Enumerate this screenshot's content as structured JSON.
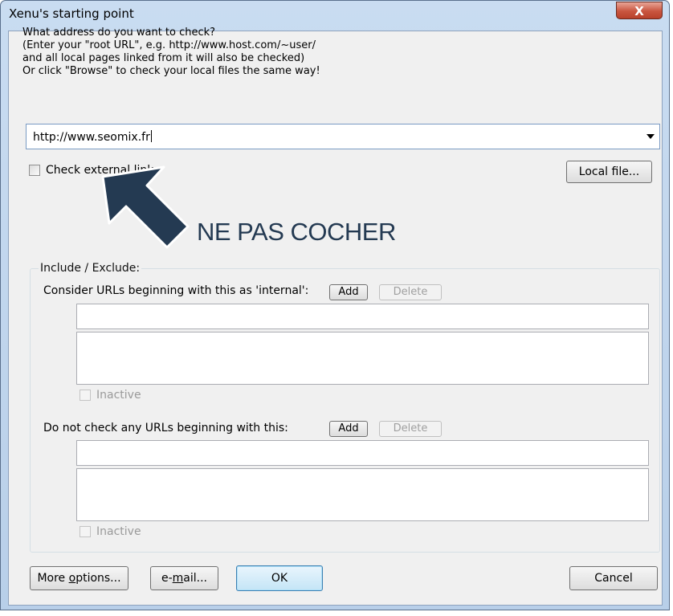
{
  "window": {
    "title": "Xenu's starting point",
    "close_label": "X"
  },
  "prompt": {
    "lines": [
      "What address do you want to check?",
      "(Enter your \"root URL\", e.g. http://www.host.com/~user/",
      "and all local pages linked from it will also be checked)",
      "Or click \"Browse\" to check your local files the same way!"
    ]
  },
  "url_input": {
    "value": "http://www.seomix.fr"
  },
  "check_external": {
    "label": "Check external links",
    "checked": false
  },
  "local_file_button": "Local file...",
  "annotation": {
    "text": "NE PAS COCHER",
    "color": "#243a52"
  },
  "include_exclude": {
    "title": "Include / Exclude:",
    "internal": {
      "label": "Consider URLs beginning with this as 'internal':",
      "add_label": "Add",
      "delete_label": "Delete",
      "input_value": "",
      "list_items": [],
      "inactive_label": "Inactive"
    },
    "exclude": {
      "label": "Do not check any URLs beginning with this:",
      "add_label": "Add",
      "delete_label": "Delete",
      "input_value": "",
      "list_items": [],
      "inactive_label": "Inactive"
    }
  },
  "footer": {
    "more_options_pre": "More ",
    "more_options_key": "o",
    "more_options_post": "ptions...",
    "email_pre": "e-",
    "email_key": "m",
    "email_post": "ail...",
    "ok_label": "OK",
    "cancel_label": "Cancel"
  }
}
